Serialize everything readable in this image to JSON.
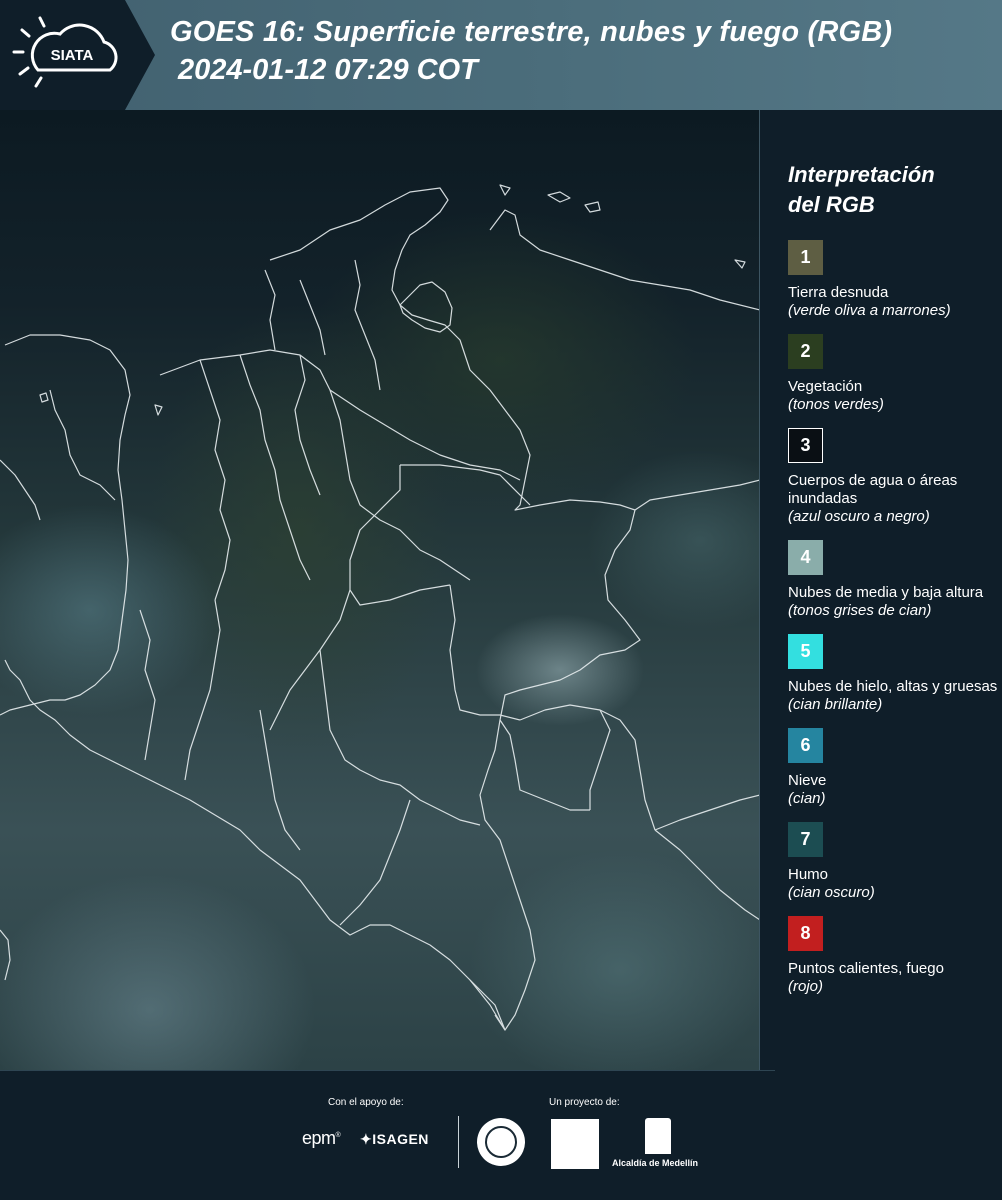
{
  "header": {
    "logo_text": "SIATA",
    "title": "GOES 16: Superficie terrestre, nubes y fuego (RGB)",
    "subtitle": "2024-01-12 07:29 COT"
  },
  "legend": {
    "title_line1": "Interpretación",
    "title_line2": "del RGB",
    "items": [
      {
        "number": "1",
        "color": "#5e5e43",
        "name": "Tierra desnuda",
        "desc": "(verde oliva a marrones)"
      },
      {
        "number": "2",
        "color": "#2b3e20",
        "name": "Vegetación",
        "desc": "(tonos verdes)"
      },
      {
        "number": "3",
        "color": "#0a0f14",
        "name": "Cuerpos de agua o áreas inundadas",
        "desc": "(azul oscuro a negro)"
      },
      {
        "number": "4",
        "color": "#8aadaa",
        "name": "Nubes de media y baja altura",
        "desc": "(tonos grises de cian)"
      },
      {
        "number": "5",
        "color": "#33dfe0",
        "name": "Nubes de hielo, altas y gruesas",
        "desc": "(cian brillante)"
      },
      {
        "number": "6",
        "color": "#2585a0",
        "name": "Nieve",
        "desc": "(cian)"
      },
      {
        "number": "7",
        "color": "#1c4d52",
        "name": "Humo",
        "desc": "(cian oscuro)"
      },
      {
        "number": "8",
        "color": "#c21f1f",
        "name": "Puntos calientes, fuego",
        "desc": "(rojo)"
      }
    ]
  },
  "footer": {
    "support_label": "Con el apoyo de:",
    "project_label": "Un proyecto de:",
    "sponsor1": "epm",
    "sponsor2": "ISAGEN",
    "partner_alcaldia": "Alcaldía de Medellín"
  }
}
